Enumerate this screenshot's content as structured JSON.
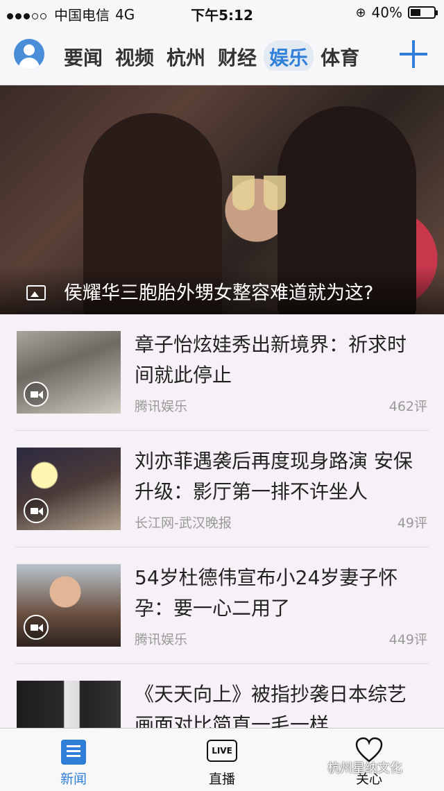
{
  "status_bar": {
    "carrier": "中国电信",
    "network": "4G",
    "time": "下午5:12",
    "battery": "40%"
  },
  "nav": {
    "tabs": [
      {
        "label": "要闻",
        "active": false
      },
      {
        "label": "视频",
        "active": false
      },
      {
        "label": "杭州",
        "active": false
      },
      {
        "label": "财经",
        "active": false
      },
      {
        "label": "娱乐",
        "active": true
      },
      {
        "label": "体育",
        "active": false
      }
    ]
  },
  "hero": {
    "caption": "侯耀华三胞胎外甥女整容难道就为这?"
  },
  "news": [
    {
      "title": "章子怡炫娃秀出新境界：祈求时间就此停止",
      "source": "腾讯娱乐",
      "comments": "462评"
    },
    {
      "title": "刘亦菲遇袭后再度现身路演 安保升级：影厅第一排不许坐人",
      "source": "长江网-武汉晚报",
      "comments": "49评"
    },
    {
      "title": "54岁杜德伟宣布小24岁妻子怀孕：要一心二用了",
      "source": "腾讯娱乐",
      "comments": "449评"
    },
    {
      "title": "《天天向上》被指抄袭日本综艺 画面对比简直一毛一样",
      "source": "",
      "comments": ""
    }
  ],
  "tabbar": {
    "items": [
      {
        "label": "新闻",
        "active": true
      },
      {
        "label": "直播",
        "active": false
      },
      {
        "label": "关心",
        "active": false
      }
    ],
    "live_badge": "LIVE"
  },
  "watermark": "杭州星纳文化",
  "colors": {
    "accent": "#2f7fd8"
  }
}
